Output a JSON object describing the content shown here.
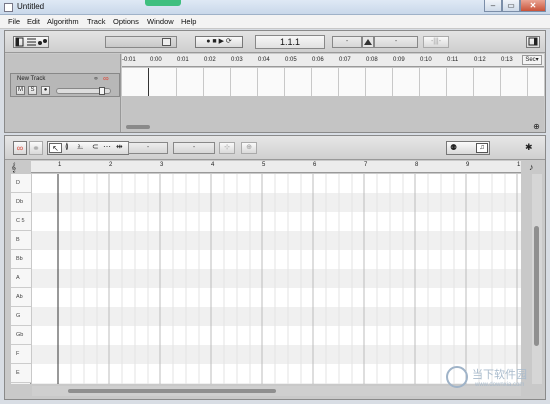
{
  "window": {
    "title": "Untitled",
    "min_glyph": "–",
    "max_glyph": "▭",
    "close_glyph": "✕"
  },
  "menu": [
    "File",
    "Edit",
    "Algorithm",
    "Track",
    "Options",
    "Window",
    "Help"
  ],
  "transport": {
    "position": "1.1.1",
    "tempo_minus": "-",
    "tempo_plus": "-",
    "extra": "-|||-",
    "record_glyph": "●",
    "stop_glyph": "■",
    "play_glyph": "▶",
    "loop_glyph": "⟳"
  },
  "timeline": {
    "labels": [
      "-0:01",
      "0:00",
      "0:01",
      "0:02",
      "0:03",
      "0:04",
      "0:05",
      "0:06",
      "0:07",
      "0:08",
      "0:09",
      "0:10",
      "0:11",
      "0:12",
      "0:13"
    ],
    "units_label": "Sec",
    "dropdown_glyph": "▾"
  },
  "track": {
    "name": "New Track",
    "mute": "M",
    "solo": "S",
    "arm_glyph": "●"
  },
  "editor": {
    "measures": [
      "1",
      "2",
      "3",
      "4",
      "5",
      "6",
      "7",
      "8",
      "9",
      "1"
    ],
    "notes": [
      "D",
      "Db",
      "C 5",
      "B",
      "Bb",
      "A",
      "Ab",
      "G",
      "Gb",
      "F",
      "E"
    ],
    "field_a": "-",
    "field_b": "-",
    "quantize_glyph": "♪",
    "gear_glyph": "✱"
  },
  "watermark": {
    "main": "当下软件园",
    "sub": "www.downxia.com"
  }
}
